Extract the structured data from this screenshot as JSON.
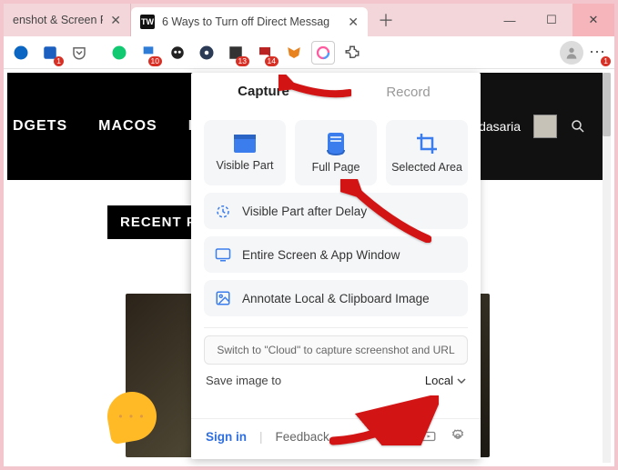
{
  "tabs": {
    "tab1_text": "enshot & Screen R",
    "tab2_text": "6 Ways to Turn off Direct Messag",
    "tab2_favicon": "TW"
  },
  "toolbar": {
    "badge1": "1",
    "badge10": "10",
    "badge13": "13",
    "badge14": "14",
    "badge_more": "1"
  },
  "page": {
    "nav1": "DGETS",
    "nav2": "MACOS",
    "nav3": "L",
    "author": "rav Bidasaria",
    "recent_heading": "RECENT PO"
  },
  "panel": {
    "tab_capture": "Capture",
    "tab_record": "Record",
    "card_visible": "Visible Part",
    "card_full": "Full Page",
    "card_selected": "Selected Area",
    "row_delay": "Visible Part after Delay",
    "row_entire": "Entire Screen & App Window",
    "row_annotate": "Annotate Local & Clipboard Image",
    "switch_hint": "Switch to \"Cloud\" to capture screenshot and URL",
    "save_label": "Save image to",
    "save_dest": "Local",
    "signin": "Sign in",
    "feedback": "Feedback"
  }
}
